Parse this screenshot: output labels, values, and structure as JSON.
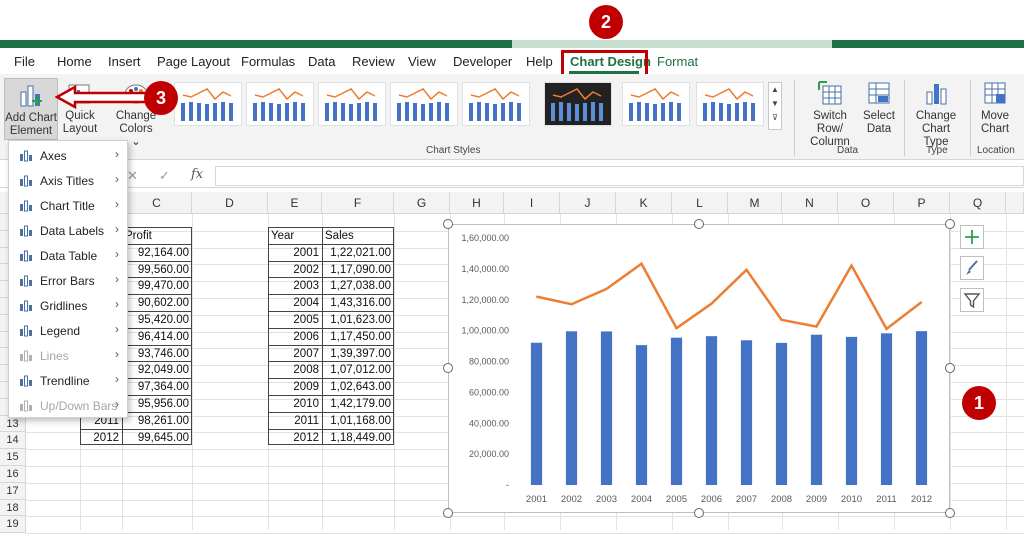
{
  "menu_tabs": [
    "File",
    "Home",
    "Insert",
    "Page Layout",
    "Formulas",
    "Data",
    "Review",
    "View",
    "Developer",
    "Help",
    "Chart Design",
    "Format"
  ],
  "ribbon": {
    "add_chart_element": [
      "Add Chart",
      "Element ⌄"
    ],
    "quick_layout": [
      "Quick",
      "Layout ⌄"
    ],
    "change_colors": [
      "Change",
      "Colors ⌄"
    ],
    "switch_row_col": [
      "Switch Row/",
      "Column"
    ],
    "select_data": [
      "Select",
      "Data"
    ],
    "change_chart_type": [
      "Change",
      "Chart Type"
    ],
    "move_chart": [
      "Move",
      "Chart"
    ],
    "groups": {
      "chart_styles": "Chart Styles",
      "data": "Data",
      "type": "Type",
      "location": "Location"
    }
  },
  "formula_bar": {
    "cancel": "✕",
    "enter": "✓",
    "fx": "fx"
  },
  "columns": [
    "C",
    "D",
    "E",
    "F",
    "G",
    "H",
    "I",
    "J",
    "K",
    "L",
    "M",
    "N",
    "O",
    "P",
    "Q"
  ],
  "rows": [
    "",
    "",
    "",
    "",
    "",
    "",
    "",
    "",
    "",
    "",
    "",
    "",
    "13",
    "14",
    "15",
    "16",
    "17",
    "18",
    "19"
  ],
  "profit_table": {
    "header": "Profit",
    "values": [
      "92,164.00",
      "99,560.00",
      "99,470.00",
      "90,602.00",
      "95,420.00",
      "96,414.00",
      "93,746.00",
      "92,049.00",
      "97,364.00",
      "95,956.00",
      "98,261.00",
      "99,645.00"
    ],
    "years_visible": [
      "2011",
      "2012"
    ]
  },
  "sales_table": {
    "headers": [
      "Year",
      "Sales"
    ],
    "years": [
      "2001",
      "2002",
      "2003",
      "2004",
      "2005",
      "2006",
      "2007",
      "2008",
      "2009",
      "2010",
      "2011",
      "2012"
    ],
    "sales": [
      "1,22,021.00",
      "1,17,090.00",
      "1,27,038.00",
      "1,43,316.00",
      "1,01,623.00",
      "1,17,450.00",
      "1,39,397.00",
      "1,07,012.00",
      "1,02,643.00",
      "1,42,179.00",
      "1,01,168.00",
      "1,18,449.00"
    ]
  },
  "context_menu": [
    {
      "label": "Axes",
      "arrow": "›",
      "disabled": false
    },
    {
      "label": "Axis Titles",
      "arrow": "›",
      "disabled": false
    },
    {
      "label": "Chart Title",
      "arrow": "›",
      "disabled": false
    },
    {
      "label": "Data Labels",
      "arrow": "›",
      "disabled": false
    },
    {
      "label": "Data Table",
      "arrow": "›",
      "disabled": false
    },
    {
      "label": "Error Bars",
      "arrow": "›",
      "disabled": false
    },
    {
      "label": "Gridlines",
      "arrow": "›",
      "disabled": false
    },
    {
      "label": "Legend",
      "arrow": "›",
      "disabled": false
    },
    {
      "label": "Lines",
      "arrow": "›",
      "disabled": true
    },
    {
      "label": "Trendline",
      "arrow": "›",
      "disabled": false
    },
    {
      "label": "Up/Down Bars",
      "arrow": "›",
      "disabled": true
    }
  ],
  "badges": {
    "one": "1",
    "two": "2",
    "three": "3"
  },
  "colors": {
    "bar": "#4472c4",
    "line": "#ed7d31",
    "accent": "#1e7145",
    "badge": "#c00000"
  },
  "chart_data": {
    "type": "bar",
    "categories": [
      "2001",
      "2002",
      "2003",
      "2004",
      "2005",
      "2006",
      "2007",
      "2008",
      "2009",
      "2010",
      "2011",
      "2012"
    ],
    "series": [
      {
        "values": [
          92164,
          99560,
          99470,
          90602,
          95420,
          96414,
          93746,
          92049,
          97364,
          95956,
          98261,
          99645
        ],
        "mark": "bar"
      },
      {
        "values": [
          122021,
          117090,
          127038,
          143316,
          101623,
          117450,
          139397,
          107012,
          102643,
          142179,
          101168,
          118449
        ],
        "mark": "line"
      }
    ],
    "yticks": [
      "-",
      "20,000.00",
      "40,000.00",
      "60,000.00",
      "80,000.00",
      "1,00,000.00",
      "1,20,000.00",
      "1,40,000.00",
      "1,60,000.00"
    ],
    "ylim": [
      0,
      160000
    ],
    "grid": false
  }
}
